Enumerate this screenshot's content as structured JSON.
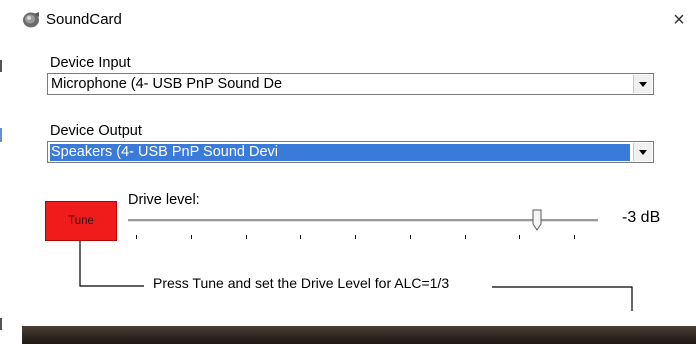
{
  "window": {
    "title": "SoundCard",
    "icon": "speaker-icon",
    "close_glyph": "×"
  },
  "device_input": {
    "label": "Device Input",
    "selected": "Microphone (4- USB PnP Sound De"
  },
  "device_output": {
    "label": "Device Output",
    "selected": "Speakers (4- USB PnP Sound Devi"
  },
  "tune": {
    "label": "Tune",
    "color": "#f01c1c"
  },
  "drive": {
    "label": "Drive level:",
    "value_text": "-3 dB",
    "slider_position": 0.87,
    "tick_count": 9
  },
  "hint": {
    "text": "Press Tune and set the Drive Level for ALC=1/3"
  },
  "colors": {
    "selection": "#3a7ad8",
    "tune_red": "#f01c1c"
  }
}
